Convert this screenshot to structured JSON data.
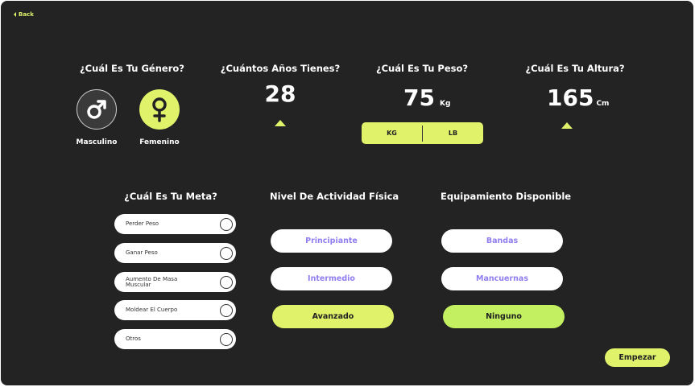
{
  "back_label": "Back",
  "gender": {
    "title": "¿Cuál Es Tu Género?",
    "options": [
      {
        "label": "Masculino",
        "icon": "male-symbol-icon"
      },
      {
        "label": "Femenino",
        "icon": "female-symbol-icon"
      }
    ],
    "selected": "Femenino"
  },
  "age": {
    "title": "¿Cuántos Años Tienes?",
    "value": "28"
  },
  "weight": {
    "title": "¿Cuál Es Tu Peso?",
    "value": "75",
    "unit": "Kg",
    "unit_options": [
      "KG",
      "LB"
    ]
  },
  "height": {
    "title": "¿Cuál Es Tu Altura?",
    "value": "165",
    "unit": "Cm"
  },
  "goal": {
    "title": "¿Cuál Es Tu Meta?",
    "options": [
      "Perder Peso",
      "Ganar Peso",
      "Aumento De Masa Muscular",
      "Moldear El Cuerpo",
      "Otros"
    ]
  },
  "activity": {
    "title": "Nivel De Actividad Física",
    "options": [
      "Principiante",
      "Intermedio",
      "Avanzado"
    ],
    "selected": "Avanzado"
  },
  "equipment": {
    "title": "Equipamiento Disponible",
    "options": [
      "Bandas",
      "Mancuernas",
      "Ninguno"
    ],
    "selected": "Ninguno"
  },
  "start_label": "Empezar",
  "colors": {
    "accent": "#dff26a",
    "selected_green": "#c2f060",
    "background": "#232323",
    "option_text": "#8f7ef0"
  }
}
